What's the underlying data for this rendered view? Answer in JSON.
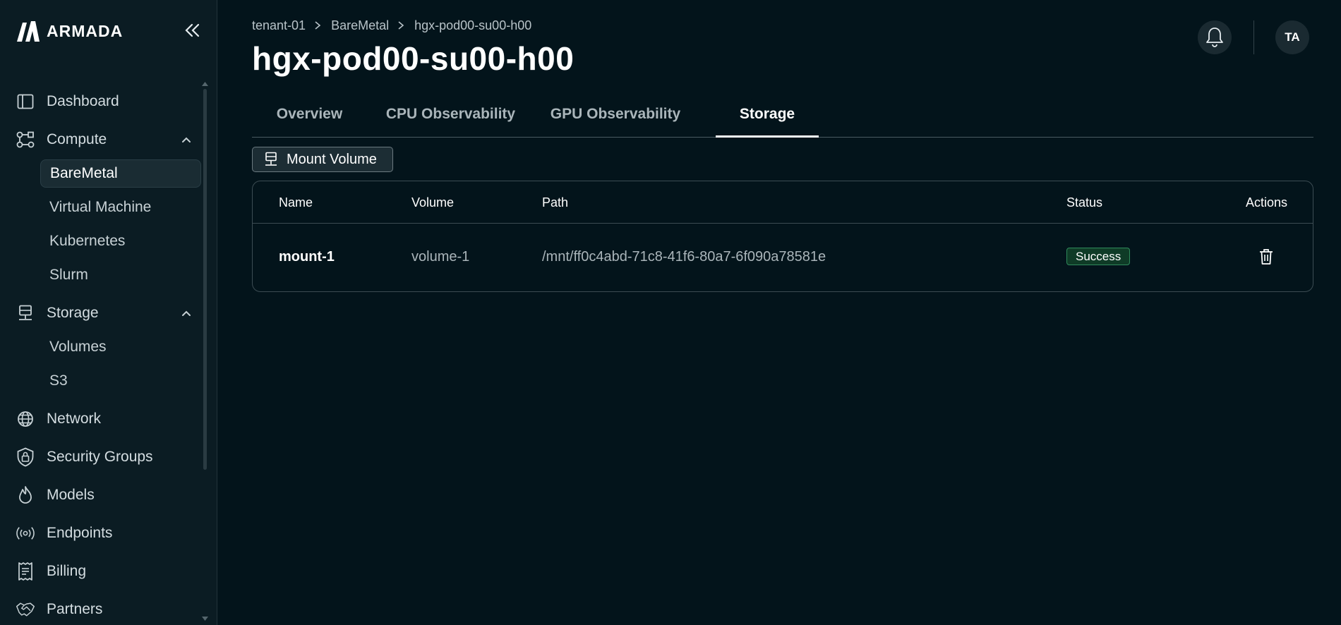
{
  "app": {
    "brand": "ARMADA"
  },
  "sidebar": {
    "items": [
      {
        "label": "Dashboard",
        "icon": "dashboard-icon"
      },
      {
        "label": "Compute",
        "icon": "compute-icon",
        "expanded": true,
        "children": [
          {
            "label": "BareMetal",
            "active": true
          },
          {
            "label": "Virtual Machine"
          },
          {
            "label": "Kubernetes"
          },
          {
            "label": "Slurm"
          }
        ]
      },
      {
        "label": "Storage",
        "icon": "storage-icon",
        "expanded": true,
        "children": [
          {
            "label": "Volumes"
          },
          {
            "label": "S3"
          }
        ]
      },
      {
        "label": "Network",
        "icon": "globe-icon"
      },
      {
        "label": "Security Groups",
        "icon": "shield-lock-icon"
      },
      {
        "label": "Models",
        "icon": "flame-icon"
      },
      {
        "label": "Endpoints",
        "icon": "broadcast-icon"
      },
      {
        "label": "Billing",
        "icon": "receipt-icon"
      },
      {
        "label": "Partners",
        "icon": "handshake-icon"
      }
    ]
  },
  "header": {
    "breadcrumb": [
      "tenant-01",
      "BareMetal",
      "hgx-pod00-su00-h00"
    ],
    "title": "hgx-pod00-su00-h00",
    "avatar_initials": "TA"
  },
  "tabs": [
    {
      "label": "Overview"
    },
    {
      "label": "CPU Observability"
    },
    {
      "label": "GPU Observability"
    },
    {
      "label": "Storage",
      "active": true
    }
  ],
  "toolbar": {
    "mount_label": "Mount Volume"
  },
  "table": {
    "columns": [
      "Name",
      "Volume",
      "Path",
      "Status",
      "Actions"
    ],
    "rows": [
      {
        "name": "mount-1",
        "volume": "volume-1",
        "path": "/mnt/ff0c4abd-71c8-41f6-80a7-6f090a78581e",
        "status": "Success"
      }
    ]
  },
  "colors": {
    "background": "#03141b",
    "sidebar": "#0b1c23",
    "success": "#2f8a5b"
  }
}
